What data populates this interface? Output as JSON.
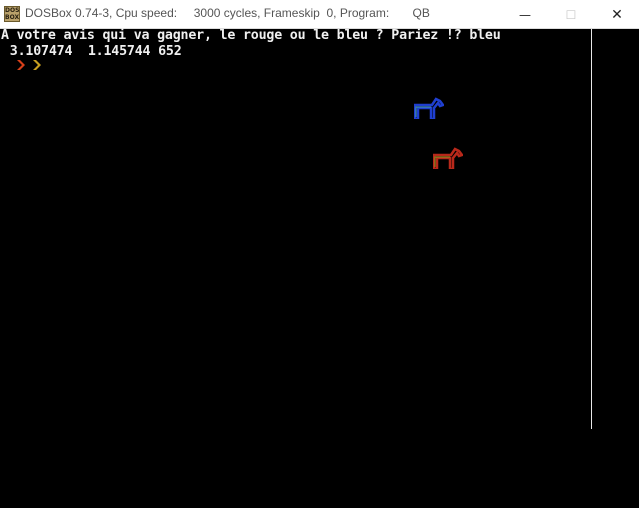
{
  "window": {
    "icon_label": "DOS BOX",
    "title": "DOSBox 0.74-3, Cpu speed:     3000 cycles, Frameskip  0, Program:       QB",
    "minimize_symbol": "—",
    "maximize_symbol": "☐",
    "close_symbol": "✕"
  },
  "console": {
    "lines": [
      "A votre avis qui va gagner, le rouge ou le bleu ? Pariez !? bleu",
      " 3.107474  1.145744 652"
    ]
  },
  "sprites": {
    "prompt_arrows_colors": [
      "#d8401a",
      "#c9a020"
    ],
    "blue_horse_color": "#1f3fd0",
    "blue_horse_accent": "#4aa0b0",
    "red_horse_color": "#b8281a",
    "red_horse_accent": "#8a9a20"
  }
}
